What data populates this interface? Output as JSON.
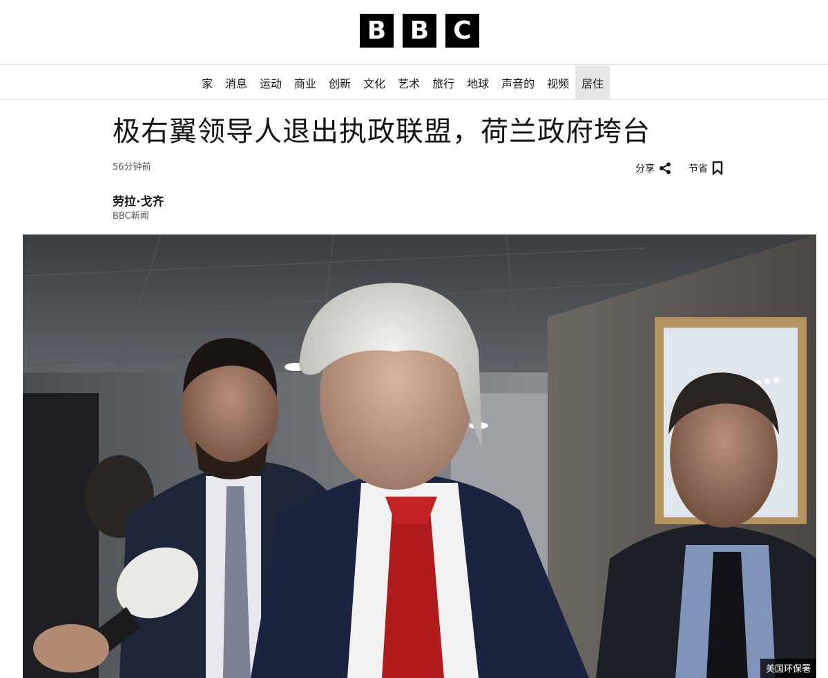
{
  "header": {
    "logo_letters": [
      "B",
      "B",
      "C"
    ]
  },
  "nav": {
    "items": [
      "家",
      "消息",
      "运动",
      "商业",
      "创新",
      "文化",
      "艺术",
      "旅行",
      "地球",
      "声音的",
      "视频",
      "居住"
    ],
    "active_index": 11
  },
  "article": {
    "headline": "极右翼领导人退出执政联盟，荷兰政府垮台",
    "timestamp": "56分钟前",
    "share_label": "分享",
    "save_label": "节省",
    "author_name": "劳拉·戈齐",
    "author_org": "BBC新闻",
    "image_credit": "美国环保署"
  },
  "icons": {
    "share": "share-icon",
    "save": "bookmark-icon"
  }
}
